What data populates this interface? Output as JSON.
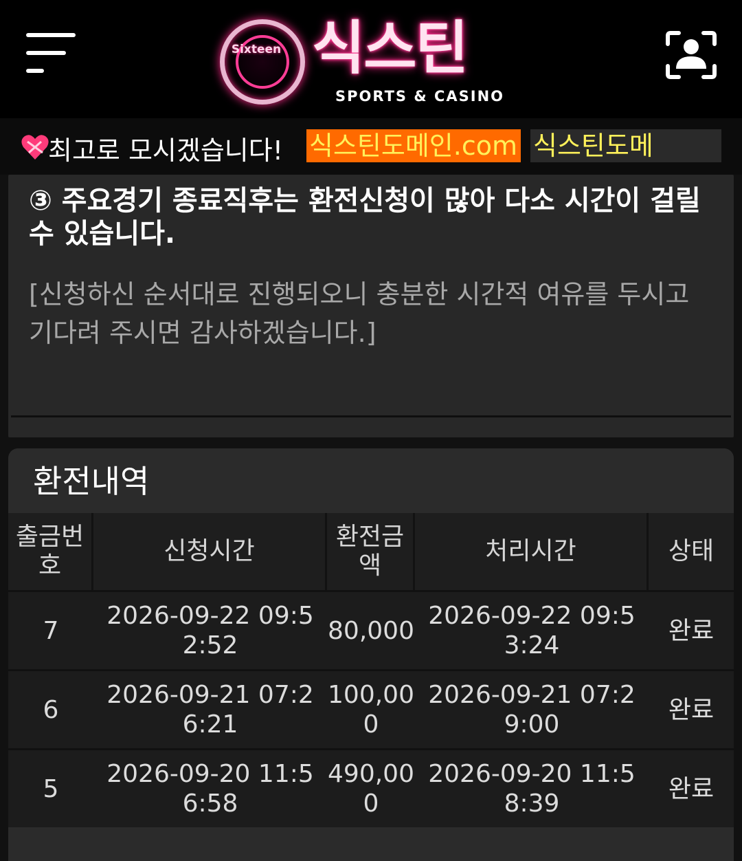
{
  "header": {
    "logo_badge_text": "Sixteen",
    "logo_title": "식스틴",
    "logo_subtitle": "SPORTS & CASINO"
  },
  "ticker": {
    "text": "최고로 모시겠습니다!",
    "domain_1": "식스틴도메인.com",
    "domain_2": "식스틴도메인.com"
  },
  "notice": {
    "title": "③ 주요경기 종료직후는 환전신청이 많아 다소 시간이 걸릴 수 있습니다.",
    "subtitle": "[신청하신 순서대로 진행되오니 충분한 시간적 여유를 두시고 기다려 주시면 감사하겠습니다.]"
  },
  "history": {
    "title": "환전내역",
    "columns": [
      "출금번호",
      "신청시간",
      "환전금액",
      "처리시간",
      "상태"
    ],
    "rows": [
      {
        "no": "7",
        "requested": "2026-09-22 09:52:52",
        "amount": "80,000",
        "processed": "2026-09-22 09:53:24",
        "status": "완료"
      },
      {
        "no": "6",
        "requested": "2026-09-21 07:26:21",
        "amount": "100,000",
        "processed": "2026-09-21 07:29:00",
        "status": "완료"
      },
      {
        "no": "5",
        "requested": "2026-09-20 11:56:58",
        "amount": "490,000",
        "processed": "2026-09-20 11:58:39",
        "status": "완료"
      }
    ]
  }
}
